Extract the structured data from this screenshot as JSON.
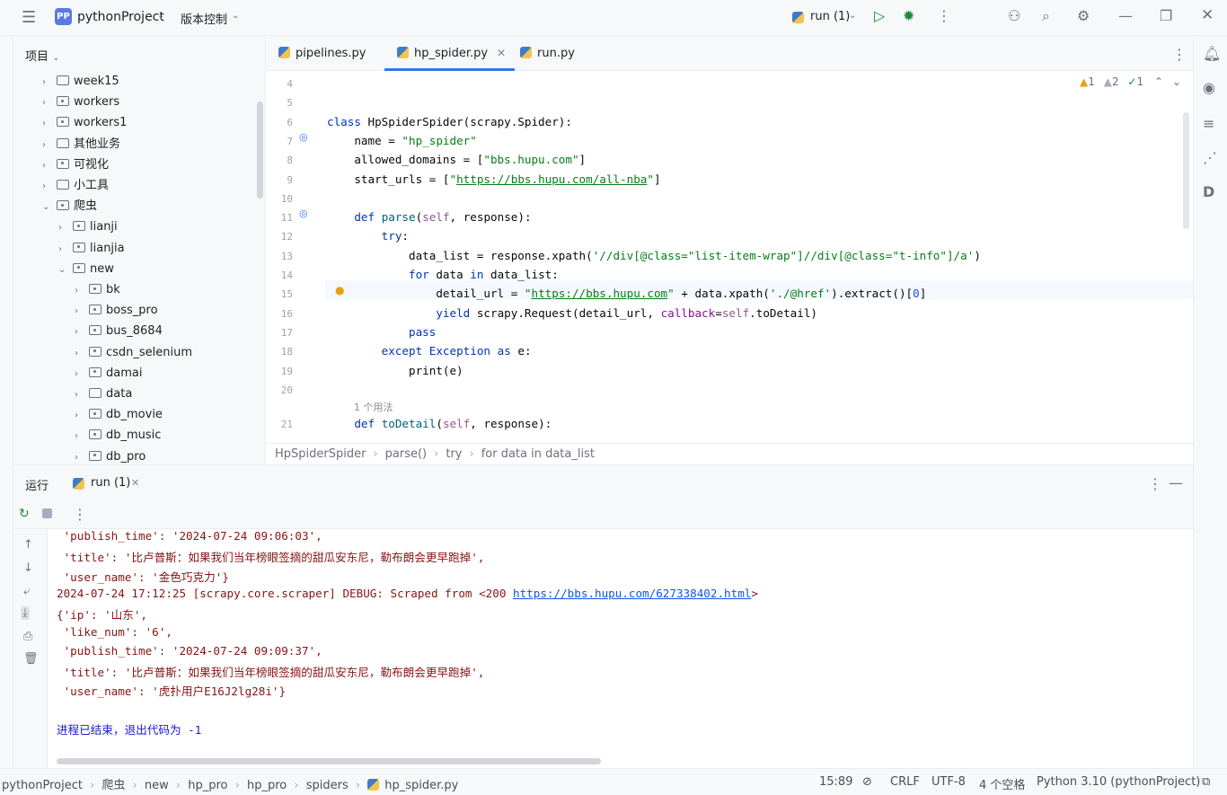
{
  "topbar": {
    "project_badge": "PP",
    "project_name": "pythonProject",
    "vcs": "版本控制",
    "run_config": "run (1)"
  },
  "project_panel": {
    "title": "项目",
    "items": [
      {
        "label": "week15",
        "type": "folder"
      },
      {
        "label": "workers",
        "type": "package"
      },
      {
        "label": "workers1",
        "type": "package"
      },
      {
        "label": "其他业务",
        "type": "folder"
      },
      {
        "label": "可视化",
        "type": "package"
      },
      {
        "label": "小工具",
        "type": "folder"
      },
      {
        "label": "爬虫",
        "type": "package"
      },
      {
        "label": "lianji",
        "type": "package"
      },
      {
        "label": "lianjia",
        "type": "package"
      },
      {
        "label": "new",
        "type": "package"
      },
      {
        "label": "bk",
        "type": "package"
      },
      {
        "label": "boss_pro",
        "type": "package"
      },
      {
        "label": "bus_8684",
        "type": "package"
      },
      {
        "label": "csdn_selenium",
        "type": "package"
      },
      {
        "label": "damai",
        "type": "package"
      },
      {
        "label": "data",
        "type": "folder"
      },
      {
        "label": "db_movie",
        "type": "package"
      },
      {
        "label": "db_music",
        "type": "package"
      },
      {
        "label": "db_pro",
        "type": "package"
      }
    ]
  },
  "editor": {
    "tabs": [
      "pipelines.py",
      "hp_spider.py",
      "run.py"
    ],
    "inspections": {
      "warn": "1",
      "weak": "2",
      "ok": "1"
    },
    "usage_hint": "1 个用法",
    "lines": [
      {
        "n": "4",
        "html": ""
      },
      {
        "n": "5",
        "html": ""
      },
      {
        "n": "6",
        "html": "<span class=\"kw\">class</span> HpSpiderSpider(scrapy.Spider):"
      },
      {
        "n": "7",
        "html": "    name = <span class=\"str\">\"hp_spider\"</span>"
      },
      {
        "n": "8",
        "html": "    allowed_domains = [<span class=\"str\">\"bbs.hupu.com\"</span>]"
      },
      {
        "n": "9",
        "html": "    start_urls = [<span class=\"str\">\"<u>https://bbs.hupu.com/all-nba</u>\"</span>]"
      },
      {
        "n": "10",
        "html": ""
      },
      {
        "n": "11",
        "html": "    <span class=\"kw\">def</span> <span class=\"fn\">parse</span>(<span class=\"self\">self</span>, response):"
      },
      {
        "n": "12",
        "html": "        <span class=\"kw\">try</span>:"
      },
      {
        "n": "13",
        "html": "            data_list = response.xpath(<span class=\"str\">'//div[@class=\"list-item-wrap\"]//div[@class=\"t-info\"]/a'</span>)"
      },
      {
        "n": "14",
        "html": "            <span class=\"kw\">for</span> data <span class=\"kw\">in</span> data_list:"
      },
      {
        "n": "15",
        "html": "                detail_url = <span class=\"str\">\"<u>https://bbs.hupu.com</u>\"</span> + data.xpath(<span class=\"str\">'./@href'</span>).extract()[<span class=\"num\">0</span>]"
      },
      {
        "n": "16",
        "html": "                <span class=\"kw\">yield</span> scrapy.Request(detail_url, <span class=\"param\">callback</span>=<span class=\"self\">self</span>.toDetail)"
      },
      {
        "n": "17",
        "html": "            <span class=\"kw\">pass</span>"
      },
      {
        "n": "18",
        "html": "        <span class=\"kw\">except</span> <span class=\"kw\">Exception</span> <span class=\"kw\">as</span> e:"
      },
      {
        "n": "19",
        "html": "            print(e)"
      },
      {
        "n": "20",
        "html": ""
      },
      {
        "n": "21",
        "html": "    <span class=\"kw\">def</span> <span class=\"fn\">toDetail</span>(<span class=\"self\">self</span>, response):"
      }
    ],
    "breadcrumb": [
      "HpSpiderSpider",
      "parse()",
      "try",
      "for data in data_list"
    ]
  },
  "run_panel": {
    "title": "运行",
    "tab": "run (1)",
    "output": [
      {
        "text": " 'publish_time': '2024-07-24 09:06:03',",
        "cls": ""
      },
      {
        "text": " 'title': '比卢普斯：如果我们当年榜眼签摘的甜瓜安东尼，勒布朗会更早跑掉',",
        "cls": ""
      },
      {
        "text": " 'user_name': '金色巧克力'}",
        "cls": ""
      },
      {
        "text": "2024-07-24 17:12:25 [scrapy.core.scraper] DEBUG: Scraped from <200 ",
        "cls": "",
        "link": "https://bbs.hupu.com/627338402.html",
        "tail": ">"
      },
      {
        "text": "{'ip': '山东',",
        "cls": ""
      },
      {
        "text": " 'like_num': '6',",
        "cls": ""
      },
      {
        "text": " 'publish_time': '2024-07-24 09:09:37',",
        "cls": ""
      },
      {
        "text": " 'title': '比卢普斯：如果我们当年榜眼签摘的甜瓜安东尼，勒布朗会更早跑掉',",
        "cls": ""
      },
      {
        "text": " 'user_name': '虎扑用户E16J2lg28i'}",
        "cls": ""
      },
      {
        "text": "",
        "cls": ""
      },
      {
        "text": "进程已结束，退出代码为 -1",
        "cls": "blue"
      }
    ]
  },
  "statusbar": {
    "path": [
      "pythonProject",
      "爬虫",
      "new",
      "hp_pro",
      "hp_pro",
      "spiders",
      "hp_spider.py"
    ],
    "position": "15:89",
    "line_sep": "CRLF",
    "encoding": "UTF-8",
    "indent": "4 个空格",
    "interpreter": "Python 3.10 (pythonProject)"
  }
}
